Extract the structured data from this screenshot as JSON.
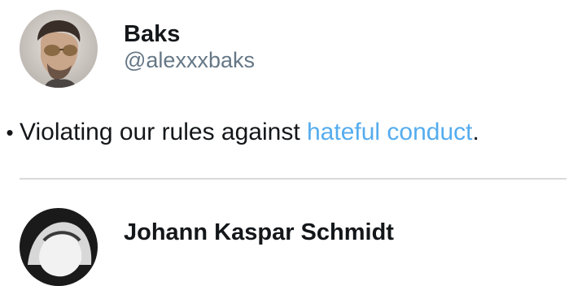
{
  "accounts": [
    {
      "display_name": "Baks",
      "handle": "@alexxxbaks"
    },
    {
      "display_name": "Johann Kaspar Schmidt"
    }
  ],
  "violation": {
    "bullet": "•",
    "prefix": "Violating our rules against ",
    "link_text": "hateful conduct",
    "suffix": "."
  },
  "colors": {
    "link": "#55acee",
    "handle": "#657786",
    "text": "#14171a",
    "divider": "#d9d9d9"
  }
}
